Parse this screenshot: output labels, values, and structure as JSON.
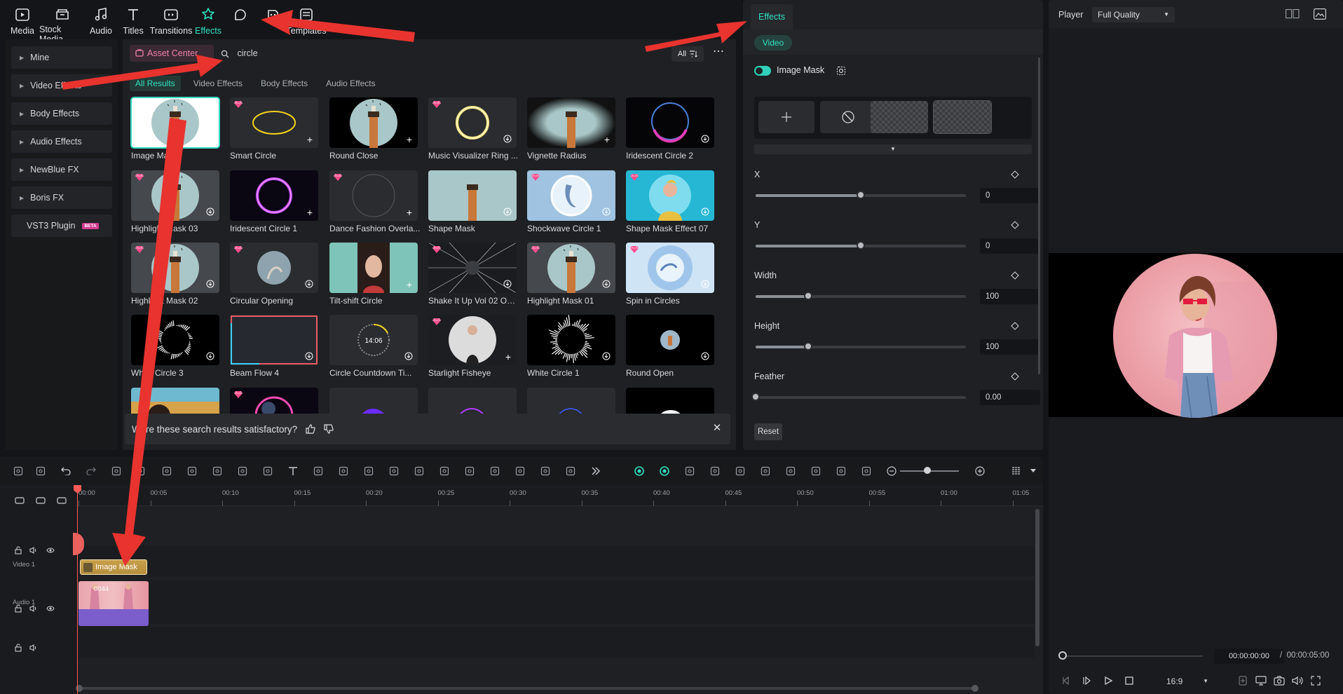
{
  "toolbar": {
    "items": [
      {
        "label": "Media",
        "icon": "media-icon"
      },
      {
        "label": "Stock Media",
        "icon": "stock-media-icon"
      },
      {
        "label": "Audio",
        "icon": "audio-icon"
      },
      {
        "label": "Titles",
        "icon": "titles-icon"
      },
      {
        "label": "Transitions",
        "icon": "transitions-icon"
      },
      {
        "label": "Effects",
        "icon": "effects-icon",
        "active": true
      },
      {
        "label": "",
        "icon": "stickers-icon"
      },
      {
        "label": "",
        "icon": "ai-icon"
      },
      {
        "label": "Templates",
        "icon": "templates-icon"
      }
    ]
  },
  "sidebar": {
    "items": [
      {
        "label": "Mine"
      },
      {
        "label": "Video Effects"
      },
      {
        "label": "Body Effects"
      },
      {
        "label": "Audio Effects"
      },
      {
        "label": "NewBlue FX"
      },
      {
        "label": "Boris FX"
      },
      {
        "label": "VST3 Plugin",
        "badge": "BETA"
      }
    ]
  },
  "search": {
    "asset_center": "Asset Center",
    "query": "circle",
    "filter_label": "All",
    "more": "⋯"
  },
  "filter_tabs": [
    "All Results",
    "Video Effects",
    "Body Effects",
    "Audio Effects"
  ],
  "effects": [
    {
      "label": "Image Mask",
      "premium": false,
      "badge": "",
      "selected": true
    },
    {
      "label": "Smart Circle",
      "premium": true,
      "badge": "+"
    },
    {
      "label": "Round Close",
      "premium": false,
      "badge": "+"
    },
    {
      "label": "Music Visualizer Ring ...",
      "premium": true,
      "badge": "download"
    },
    {
      "label": "Vignette Radius",
      "premium": false,
      "badge": "+"
    },
    {
      "label": "Iridescent Circle 2",
      "premium": false,
      "badge": "download"
    },
    {
      "label": "Highlight Mask 03",
      "premium": true,
      "badge": "download"
    },
    {
      "label": "Iridescent Circle 1",
      "premium": false,
      "badge": "+"
    },
    {
      "label": "Dance Fashion Overla...",
      "premium": true,
      "badge": "+"
    },
    {
      "label": "Shape Mask",
      "premium": false,
      "badge": "download"
    },
    {
      "label": "Shockwave Circle 1",
      "premium": true,
      "badge": "download"
    },
    {
      "label": "Shape Mask Effect 07",
      "premium": true,
      "badge": "download"
    },
    {
      "label": "Highlight Mask 02",
      "premium": true,
      "badge": "download"
    },
    {
      "label": "Circular Opening",
      "premium": true,
      "badge": "download"
    },
    {
      "label": "Tilt-shift Circle",
      "premium": false,
      "badge": "+"
    },
    {
      "label": "Shake It Up Vol 02 Ove...",
      "premium": true,
      "badge": "download"
    },
    {
      "label": "Highlight Mask 01",
      "premium": true,
      "badge": "download"
    },
    {
      "label": "Spin in Circles",
      "premium": true,
      "badge": "download"
    },
    {
      "label": "White Circle 3",
      "premium": false,
      "badge": "download"
    },
    {
      "label": "Beam Flow 4",
      "premium": false,
      "badge": "download"
    },
    {
      "label": "Circle Countdown Ti...",
      "premium": false,
      "badge": "download",
      "text": "14:06"
    },
    {
      "label": "Starlight Fisheye",
      "premium": true,
      "badge": "+"
    },
    {
      "label": "White Circle 1",
      "premium": false,
      "badge": "download"
    },
    {
      "label": "Round Open",
      "premium": false,
      "badge": "download"
    },
    {
      "label": "",
      "premium": false,
      "badge": ""
    },
    {
      "label": "",
      "premium": true,
      "badge": ""
    },
    {
      "label": "",
      "premium": false,
      "badge": ""
    },
    {
      "label": "",
      "premium": false,
      "badge": ""
    },
    {
      "label": "",
      "premium": false,
      "badge": ""
    },
    {
      "label": "",
      "premium": false,
      "badge": ""
    }
  ],
  "feedback": {
    "question": "Were these search results satisfactory?"
  },
  "props": {
    "tab": "Effects",
    "category": "Video",
    "effect_name": "Image Mask",
    "params": [
      {
        "label": "X",
        "value": "0",
        "level": 0.5
      },
      {
        "label": "Y",
        "value": "0",
        "level": 0.5
      },
      {
        "label": "Width",
        "value": "100",
        "level": 0.25
      },
      {
        "label": "Height",
        "value": "100",
        "level": 0.25
      },
      {
        "label": "Feather",
        "value": "0.00",
        "level": 0.0
      }
    ],
    "reset": "Reset"
  },
  "player": {
    "label": "Player",
    "quality": "Full Quality",
    "timecode": "00:00:00:00",
    "separator": "/",
    "duration": "00:00:05:00",
    "ratio": "16:9"
  },
  "timeline": {
    "ticks": [
      "00:00",
      "00:05",
      "00:10",
      "00:15",
      "00:20",
      "00:25",
      "00:30",
      "00:35",
      "00:40",
      "00:45",
      "00:50",
      "00:55",
      "01:00",
      "01:05"
    ],
    "tracks": [
      {
        "label": ""
      },
      {
        "label": "Video 1"
      },
      {
        "label": "Audio 1"
      }
    ],
    "effect_clip": "Image Mask",
    "video_clip": "0044"
  },
  "colors": {
    "accent": "#2fe0c0",
    "annotation_arrow": "#e8332f",
    "premium_gem": "#ff4d8d"
  }
}
